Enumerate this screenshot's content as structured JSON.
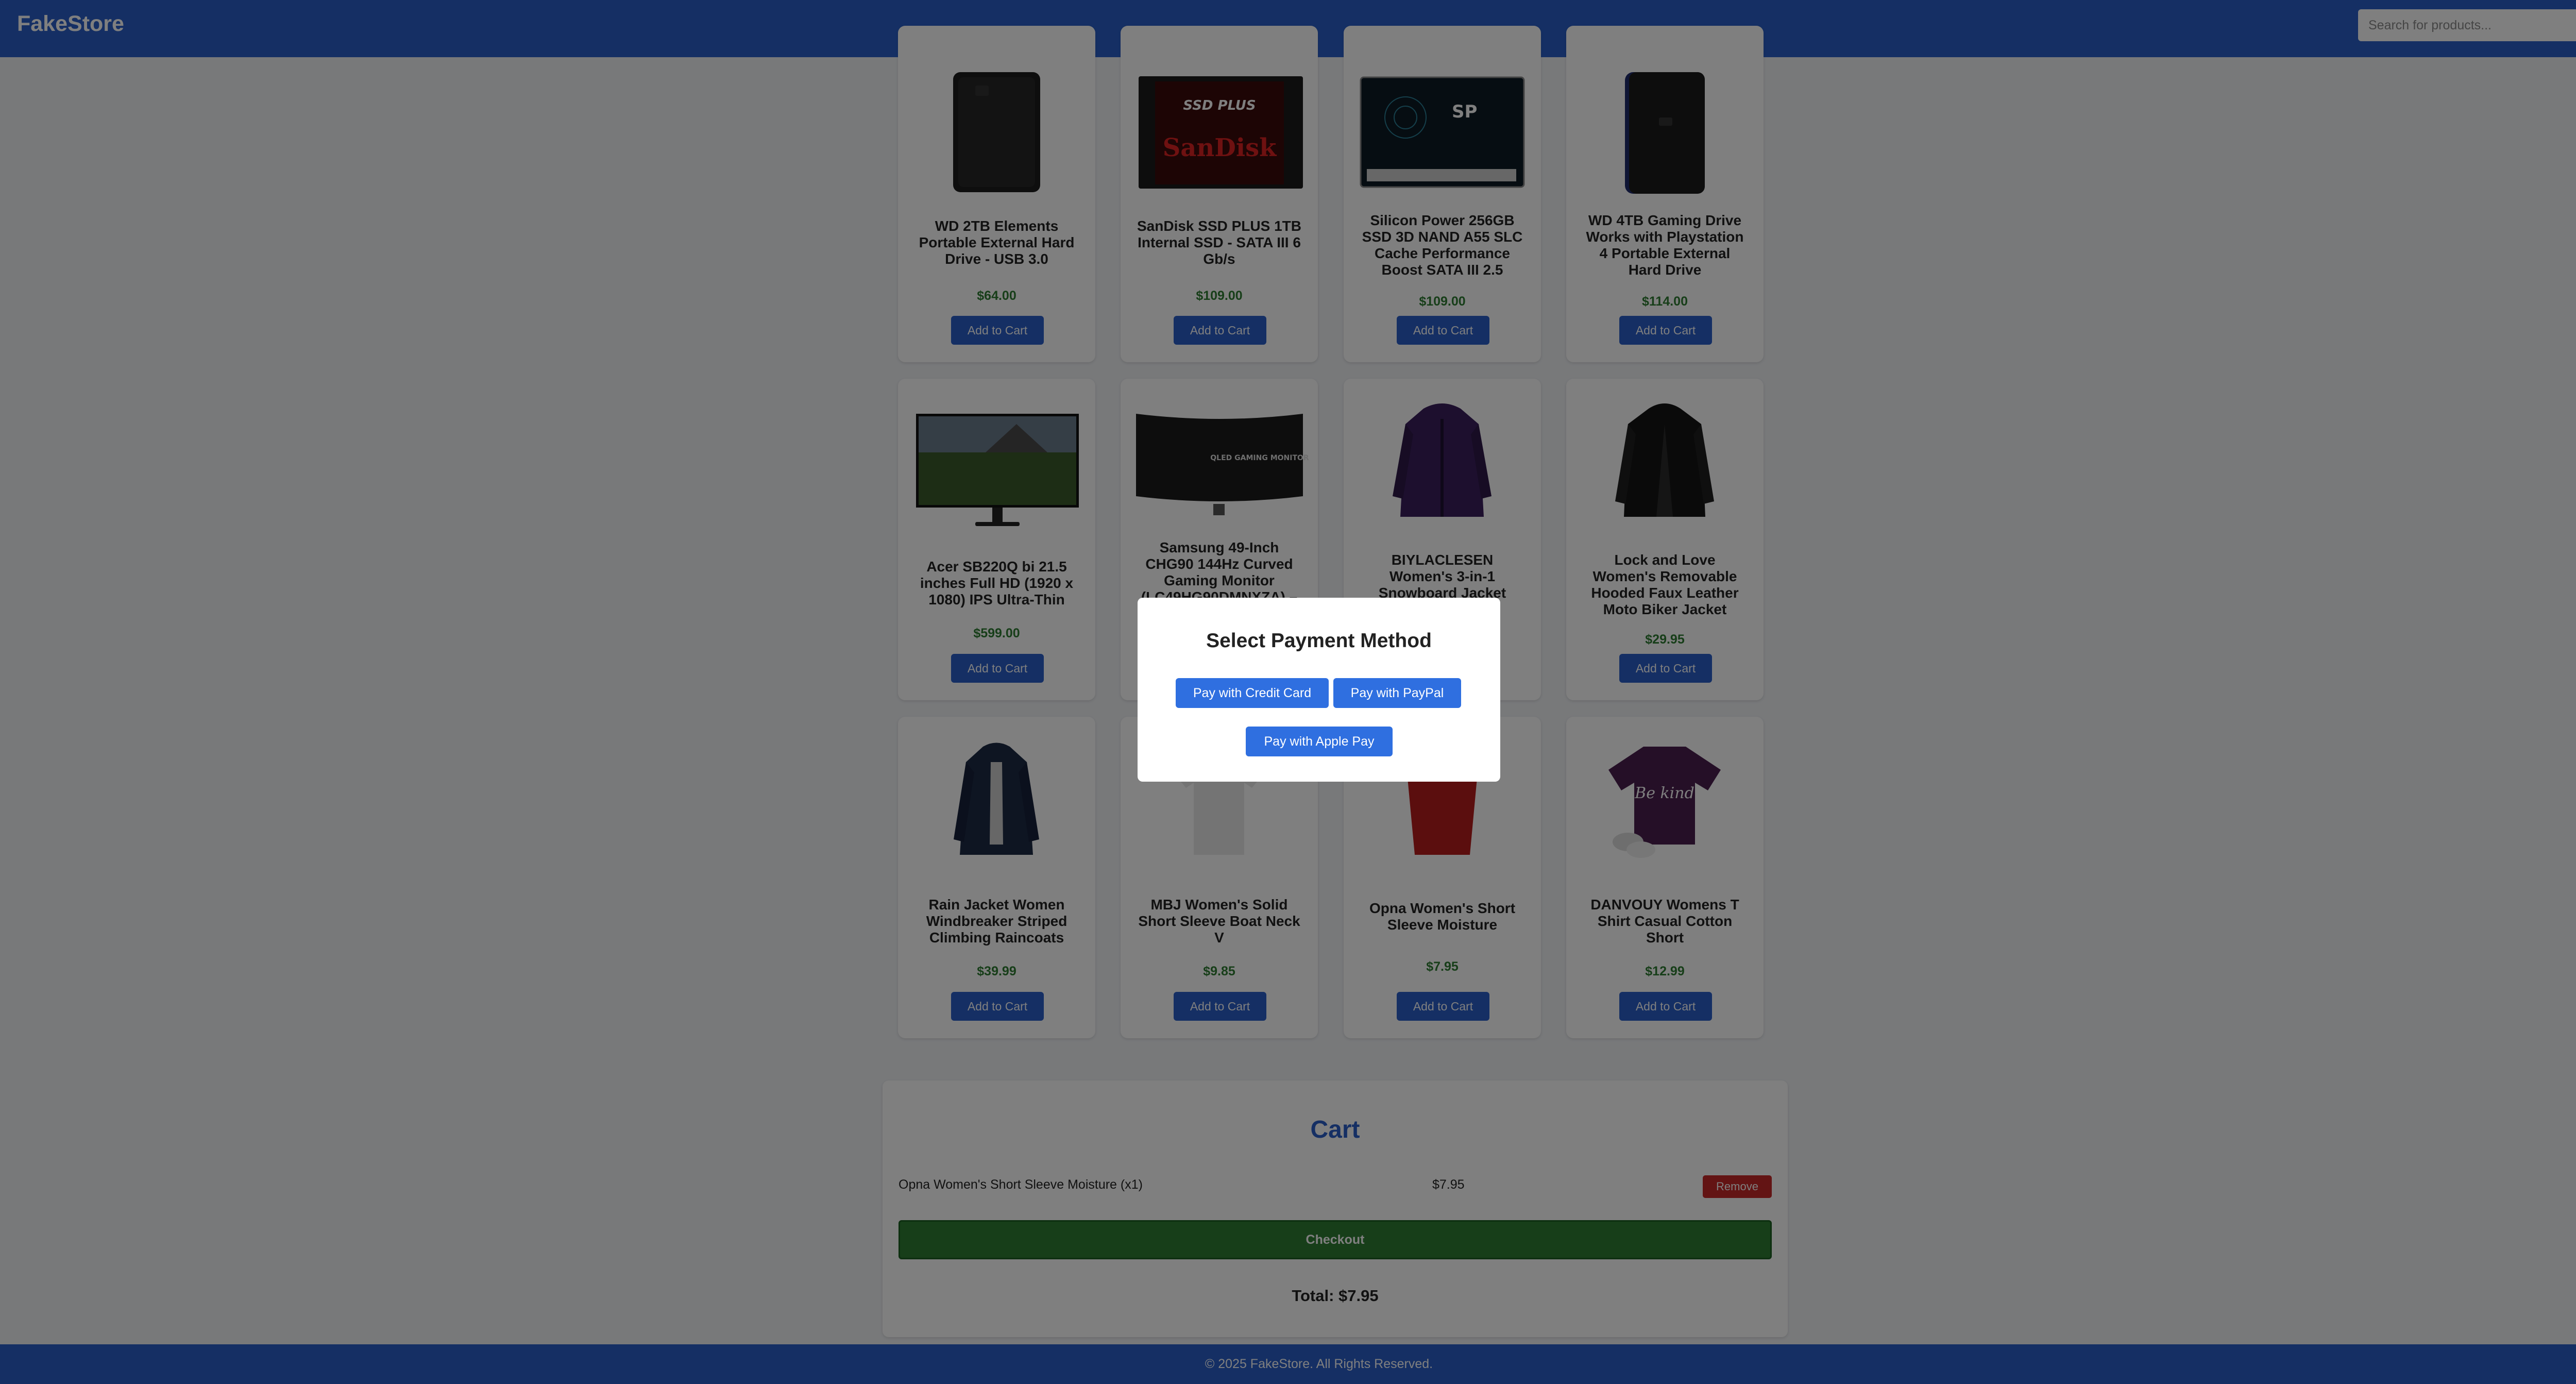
{
  "header": {
    "brand": "FakeStore",
    "search_placeholder": "Search for products...",
    "close_label": "✕"
  },
  "products": [
    {
      "title": "WD 2TB Elements Portable External Hard Drive - USB 3.0",
      "price": "$64.00",
      "button": "Add to Cart"
    },
    {
      "title": "SanDisk SSD PLUS 1TB Internal SSD - SATA III 6 Gb/s",
      "price": "$109.00",
      "button": "Add to Cart"
    },
    {
      "title": "Silicon Power 256GB SSD 3D NAND A55 SLC Cache Performance Boost SATA III 2.5",
      "price": "$109.00",
      "button": "Add to Cart"
    },
    {
      "title": "WD 4TB Gaming Drive Works with Playstation 4 Portable External Hard Drive",
      "price": "$114.00",
      "button": "Add to Cart"
    },
    {
      "title": "Acer SB220Q bi 21.5 inches Full HD (1920 x 1080) IPS Ultra-Thin",
      "price": "$599.00",
      "button": "Add to Cart"
    },
    {
      "title": "Samsung 49-Inch CHG90 144Hz Curved Gaming Monitor (LC49HG90DMNXZA) –",
      "price": "",
      "button": ""
    },
    {
      "title": "BIYLACLESEN Women's 3-in-1 Snowboard Jacket",
      "price": "",
      "button": ""
    },
    {
      "title": "Lock and Love Women's Removable Hooded Faux Leather Moto Biker Jacket",
      "price": "$29.95",
      "button": "Add to Cart"
    },
    {
      "title": "Rain Jacket Women Windbreaker Striped Climbing Raincoats",
      "price": "$39.99",
      "button": "Add to Cart"
    },
    {
      "title": "MBJ Women's Solid Short Sleeve Boat Neck V",
      "price": "$9.85",
      "button": "Add to Cart"
    },
    {
      "title": "Opna Women's Short Sleeve Moisture",
      "price": "$7.95",
      "button": "Add to Cart"
    },
    {
      "title": "DANVOUY Womens T Shirt Casual Cotton Short",
      "price": "$12.99",
      "button": "Add to Cart"
    }
  ],
  "images": {
    "ssd_brand": "SSD PLUS",
    "ssd_maker": "SanDisk",
    "sp_logo": "SP",
    "monitor_text": "QLED GAMING MONITOR",
    "tee_text": "Be kind"
  },
  "cart": {
    "title": "Cart",
    "item_name": "Opna Women's Short Sleeve Moisture (x1)",
    "item_price": "$7.95",
    "remove_label": "Remove",
    "checkout_label": "Checkout",
    "total": "Total: $7.95"
  },
  "footer": {
    "text": "© 2025 FakeStore. All Rights Reserved."
  },
  "modal": {
    "title": "Select Payment Method",
    "credit_card": "Pay with Credit Card",
    "paypal": "Pay with PayPal",
    "apple_pay": "Pay with Apple Pay"
  },
  "colors": {
    "header": "#2a5fc9",
    "price": "#2e7d32",
    "checkout": "#2e7d32",
    "remove": "#c62828",
    "pay_button": "#2f6fe0"
  }
}
